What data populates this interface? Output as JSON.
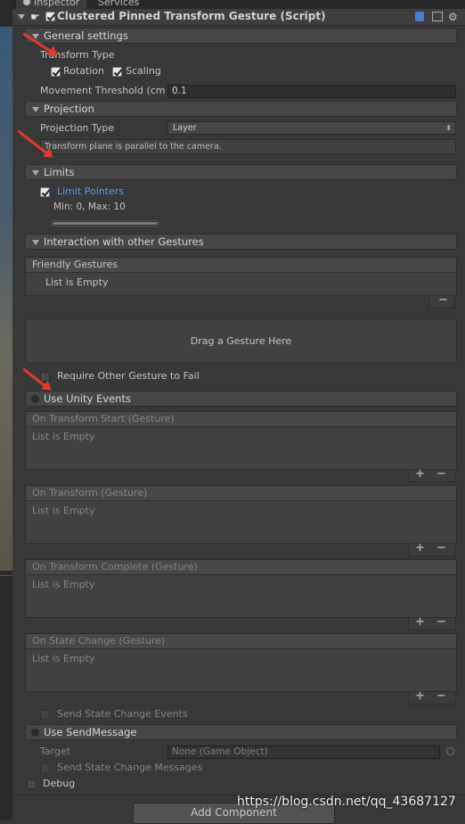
{
  "tabs": [
    "Inspector",
    "Services"
  ],
  "component": {
    "title": "Clustered Pinned Transform Gesture (Script)",
    "enabled": true
  },
  "general": {
    "header": "General settings",
    "transform_type_label": "Transform Type",
    "rotation_label": "Rotation",
    "scaling_label": "Scaling",
    "movement_threshold_label": "Movement Threshold (cm",
    "movement_threshold_value": "0.1"
  },
  "projection": {
    "header": "Projection",
    "type_label": "Projection Type",
    "type_value": "Layer",
    "info": "Transform plane is parallel to the camera."
  },
  "limits": {
    "header": "Limits",
    "limit_pointers_label": "Limit Pointers",
    "range_text": "Min: 0, Max: 10"
  },
  "interaction": {
    "header": "Interaction with other Gestures",
    "friendly_header": "Friendly Gestures",
    "friendly_empty": "List is Empty",
    "drag_here": "Drag a Gesture Here",
    "require_fail_label": "Require Other Gesture to Fail"
  },
  "unity_events": {
    "header": "Use Unity Events",
    "lists": [
      {
        "title": "On Transform Start (Gesture)",
        "empty": "List is Empty"
      },
      {
        "title": "On Transform (Gesture)",
        "empty": "List is Empty"
      },
      {
        "title": "On Transform Complete (Gesture)",
        "empty": "List is Empty"
      },
      {
        "title": "On State Change (Gesture)",
        "empty": "List is Empty"
      }
    ],
    "send_state_change_label": "Send State Change Events"
  },
  "send_message": {
    "header": "Use SendMessage",
    "target_label": "Target",
    "target_value": "None (Game Object)",
    "send_state_change_label": "Send State Change Messages"
  },
  "debug_label": "Debug",
  "add_component_label": "Add Component",
  "watermark": "https://blog.csdn.net/qq_43687127",
  "controls": {
    "plus": "+",
    "minus": "−"
  },
  "colors": {
    "link_blue": "#5a9cf5",
    "arrow_red": "#e43a2c",
    "background": "#383838"
  }
}
